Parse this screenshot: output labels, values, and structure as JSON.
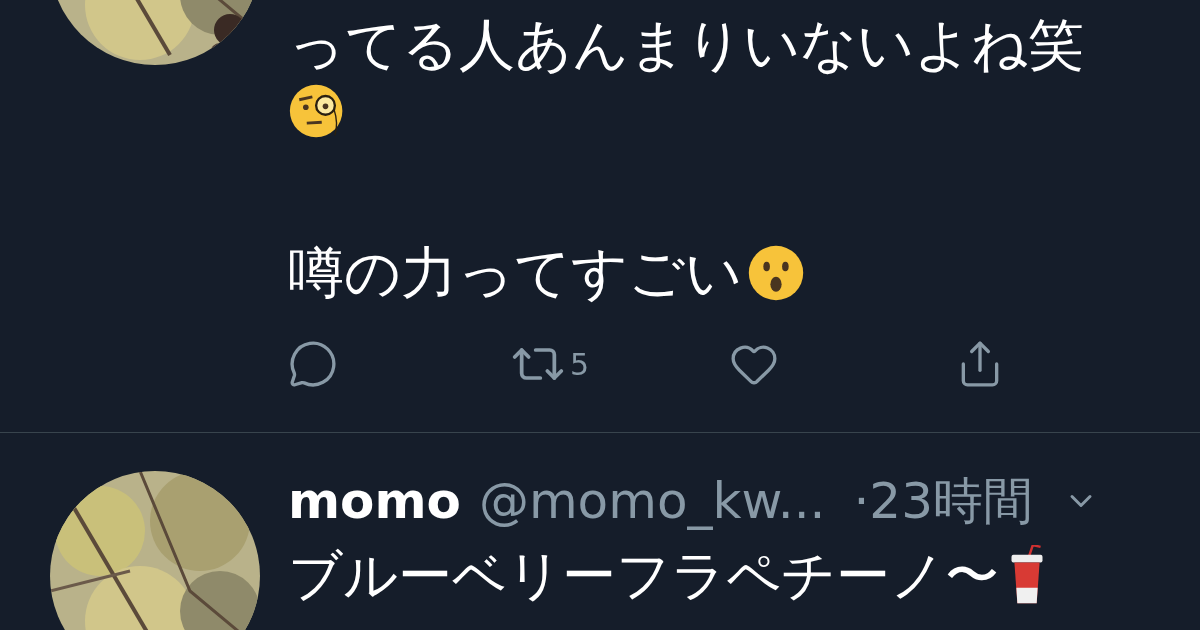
{
  "tweets": [
    {
      "lines": [
        "ってる人あんまりいないよね笑",
        "噂の力ってすごい"
      ],
      "actions": {
        "retweet_count": "5"
      }
    },
    {
      "name": "momo",
      "handle": "@momo_kw...",
      "time": "·23時間",
      "text": "ブルーベリーフラペチーノ〜"
    }
  ]
}
